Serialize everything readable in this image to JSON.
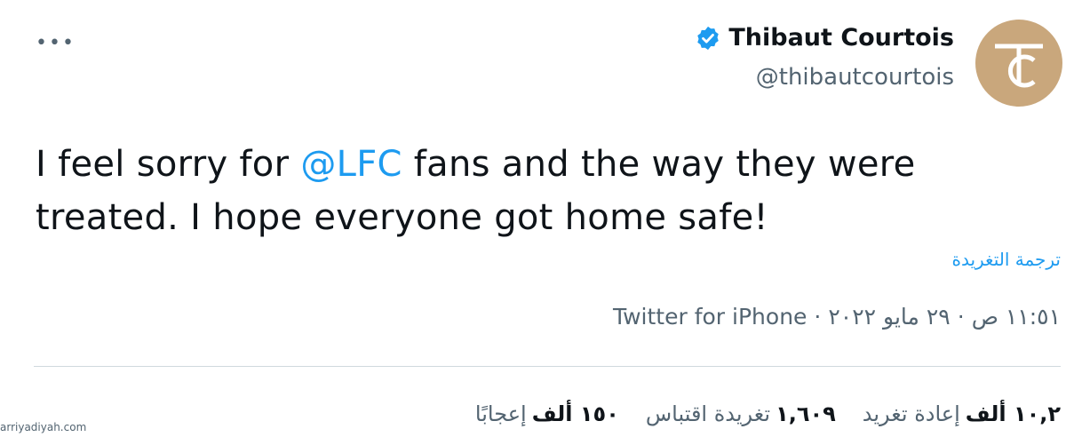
{
  "tweet": {
    "more_label": "•••",
    "author": {
      "display_name": "Thibaut Courtois",
      "handle": "@thibautcourtois",
      "verified": true,
      "avatar_icon": "tc-monogram-logo",
      "avatar_color": "#c9a77c"
    },
    "text": {
      "part1": "I feel sorry for ",
      "mention": "@LFC",
      "part2": " fans and the way they were treated. I hope everyone got home safe!"
    },
    "translate_label": "ترجمة التغريدة",
    "meta": {
      "time": "١١:٥١ ص",
      "date": "٢٩ مايو ٢٠٢٢",
      "separator": "·",
      "source": "Twitter for iPhone"
    },
    "stats": [
      {
        "value": "١٠,٢ ألف",
        "label": "إعادة تغريد"
      },
      {
        "value": "١,٦٠٩",
        "label": "تغريدة اقتباس"
      },
      {
        "value": "١٥٠ ألف",
        "label": "إعجابًا"
      }
    ],
    "colors": {
      "accent": "#1d9bf0",
      "verified": "#1d9bf0",
      "muted": "#536471"
    }
  },
  "watermark": "arriyadiyah.com"
}
